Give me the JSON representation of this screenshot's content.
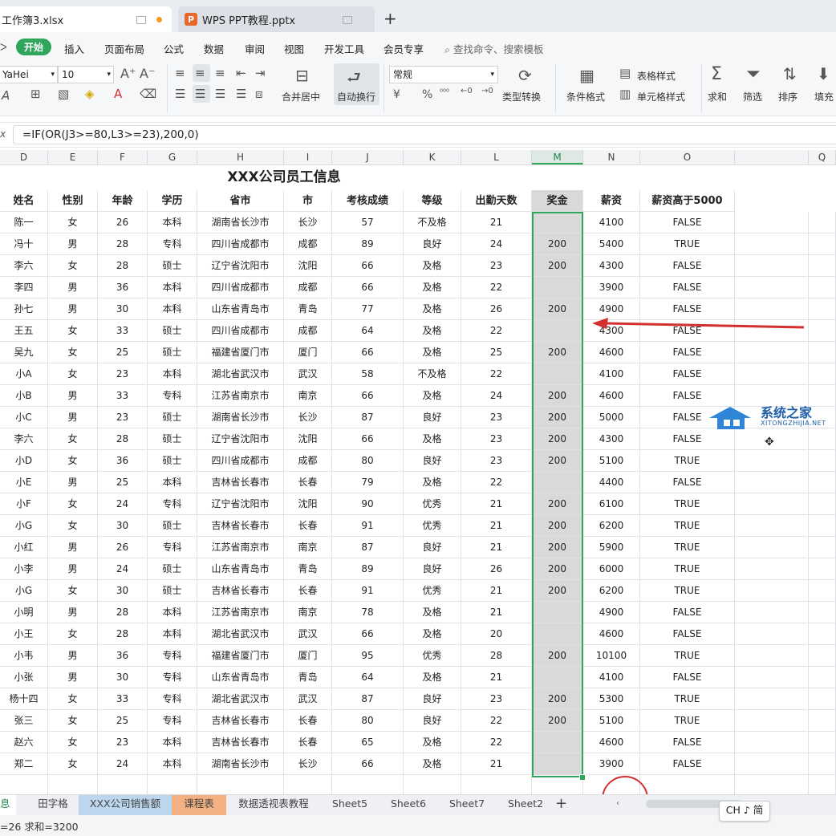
{
  "tabs": {
    "active_title": "工作簿3.xlsx",
    "inactive_title": "WPS PPT教程.pptx",
    "inactive_icon": "P",
    "add": "+"
  },
  "menu": {
    "start": "开始",
    "items": [
      "插入",
      "页面布局",
      "公式",
      "数据",
      "审阅",
      "视图",
      "开发工具",
      "会员专享"
    ],
    "search_placeholder": "查找命令、搜索模板"
  },
  "ribbon": {
    "font_name": "YaHei",
    "font_size": "10",
    "merge": "合并居中",
    "wrap": "自动换行",
    "number_format": "常规",
    "type_convert": "类型转换",
    "table_style": "表格样式",
    "cond_format": "条件格式",
    "cell_style": "单元格样式",
    "sum": "求和",
    "filter": "筛选",
    "sort": "排序",
    "fill": "填充"
  },
  "formula": {
    "prefix": "x",
    "text": "=IF(OR(J3>=80,L3>=23),200,0)"
  },
  "columns": [
    "D",
    "E",
    "F",
    "G",
    "H",
    "I",
    "J",
    "K",
    "L",
    "M",
    "N",
    "O",
    "",
    "Q"
  ],
  "sheet": {
    "title": "XXX公司员工信息",
    "headers": [
      "姓名",
      "性别",
      "年龄",
      "学历",
      "省市",
      "市",
      "考核成绩",
      "等级",
      "出勤天数",
      "奖金",
      "薪资",
      "薪资高于5000"
    ],
    "rows": [
      [
        "陈一",
        "女",
        "26",
        "本科",
        "湖南省长沙市",
        "长沙",
        "57",
        "不及格",
        "21",
        "",
        "4100",
        "FALSE"
      ],
      [
        "冯十",
        "男",
        "28",
        "专科",
        "四川省成都市",
        "成都",
        "89",
        "良好",
        "24",
        "200",
        "5400",
        "TRUE"
      ],
      [
        "李六",
        "女",
        "28",
        "硕士",
        "辽宁省沈阳市",
        "沈阳",
        "66",
        "及格",
        "23",
        "200",
        "4300",
        "FALSE"
      ],
      [
        "李四",
        "男",
        "36",
        "本科",
        "四川省成都市",
        "成都",
        "66",
        "及格",
        "22",
        "",
        "3900",
        "FALSE"
      ],
      [
        "孙七",
        "男",
        "30",
        "本科",
        "山东省青岛市",
        "青岛",
        "77",
        "及格",
        "26",
        "200",
        "4900",
        "FALSE"
      ],
      [
        "王五",
        "女",
        "33",
        "硕士",
        "四川省成都市",
        "成都",
        "64",
        "及格",
        "22",
        "",
        "4300",
        "FALSE"
      ],
      [
        "吴九",
        "女",
        "25",
        "硕士",
        "福建省厦门市",
        "厦门",
        "66",
        "及格",
        "25",
        "200",
        "4600",
        "FALSE"
      ],
      [
        "小A",
        "女",
        "23",
        "本科",
        "湖北省武汉市",
        "武汉",
        "58",
        "不及格",
        "22",
        "",
        "4100",
        "FALSE"
      ],
      [
        "小B",
        "男",
        "33",
        "专科",
        "江苏省南京市",
        "南京",
        "66",
        "及格",
        "24",
        "200",
        "4600",
        "FALSE"
      ],
      [
        "小C",
        "男",
        "23",
        "硕士",
        "湖南省长沙市",
        "长沙",
        "87",
        "良好",
        "23",
        "200",
        "5000",
        "FALSE"
      ],
      [
        "李六",
        "女",
        "28",
        "硕士",
        "辽宁省沈阳市",
        "沈阳",
        "66",
        "及格",
        "23",
        "200",
        "4300",
        "FALSE"
      ],
      [
        "小D",
        "女",
        "36",
        "硕士",
        "四川省成都市",
        "成都",
        "80",
        "良好",
        "23",
        "200",
        "5100",
        "TRUE"
      ],
      [
        "小E",
        "男",
        "25",
        "本科",
        "吉林省长春市",
        "长春",
        "79",
        "及格",
        "22",
        "",
        "4400",
        "FALSE"
      ],
      [
        "小F",
        "女",
        "24",
        "专科",
        "辽宁省沈阳市",
        "沈阳",
        "90",
        "优秀",
        "21",
        "200",
        "6100",
        "TRUE"
      ],
      [
        "小G",
        "女",
        "30",
        "硕士",
        "吉林省长春市",
        "长春",
        "91",
        "优秀",
        "21",
        "200",
        "6200",
        "TRUE"
      ],
      [
        "小红",
        "男",
        "26",
        "专科",
        "江苏省南京市",
        "南京",
        "87",
        "良好",
        "21",
        "200",
        "5900",
        "TRUE"
      ],
      [
        "小李",
        "男",
        "24",
        "硕士",
        "山东省青岛市",
        "青岛",
        "89",
        "良好",
        "26",
        "200",
        "6000",
        "TRUE"
      ],
      [
        "小G",
        "女",
        "30",
        "硕士",
        "吉林省长春市",
        "长春",
        "91",
        "优秀",
        "21",
        "200",
        "6200",
        "TRUE"
      ],
      [
        "小明",
        "男",
        "28",
        "本科",
        "江苏省南京市",
        "南京",
        "78",
        "及格",
        "21",
        "",
        "4900",
        "FALSE"
      ],
      [
        "小王",
        "女",
        "28",
        "本科",
        "湖北省武汉市",
        "武汉",
        "66",
        "及格",
        "20",
        "",
        "4600",
        "FALSE"
      ],
      [
        "小韦",
        "男",
        "36",
        "专科",
        "福建省厦门市",
        "厦门",
        "95",
        "优秀",
        "28",
        "200",
        "10100",
        "TRUE"
      ],
      [
        "小张",
        "男",
        "30",
        "专科",
        "山东省青岛市",
        "青岛",
        "64",
        "及格",
        "21",
        "",
        "4100",
        "FALSE"
      ],
      [
        "杨十四",
        "女",
        "33",
        "专科",
        "湖北省武汉市",
        "武汉",
        "87",
        "良好",
        "23",
        "200",
        "5300",
        "TRUE"
      ],
      [
        "张三",
        "女",
        "25",
        "专科",
        "吉林省长春市",
        "长春",
        "80",
        "良好",
        "22",
        "200",
        "5100",
        "TRUE"
      ],
      [
        "赵六",
        "女",
        "23",
        "本科",
        "吉林省长春市",
        "长春",
        "65",
        "及格",
        "22",
        "",
        "4600",
        "FALSE"
      ],
      [
        "郑二",
        "女",
        "24",
        "本科",
        "湖南省长沙市",
        "长沙",
        "66",
        "及格",
        "21",
        "",
        "3900",
        "FALSE"
      ]
    ]
  },
  "sheet_tabs": [
    "信息",
    "田字格",
    "XXX公司销售额",
    "课程表",
    "数据透视表教程",
    "Sheet5",
    "Sheet6",
    "Sheet7",
    "Sheet2"
  ],
  "status": {
    "text": "=26  求和=3200"
  },
  "ime": "CH ♪ 简",
  "watermark": {
    "title": "系统之家",
    "url": "XITONGZHIJIA.NET"
  },
  "colors": {
    "accent": "#2fa65b",
    "arrow": "#d32f2f",
    "selection_fill": "#d9d9d9"
  }
}
